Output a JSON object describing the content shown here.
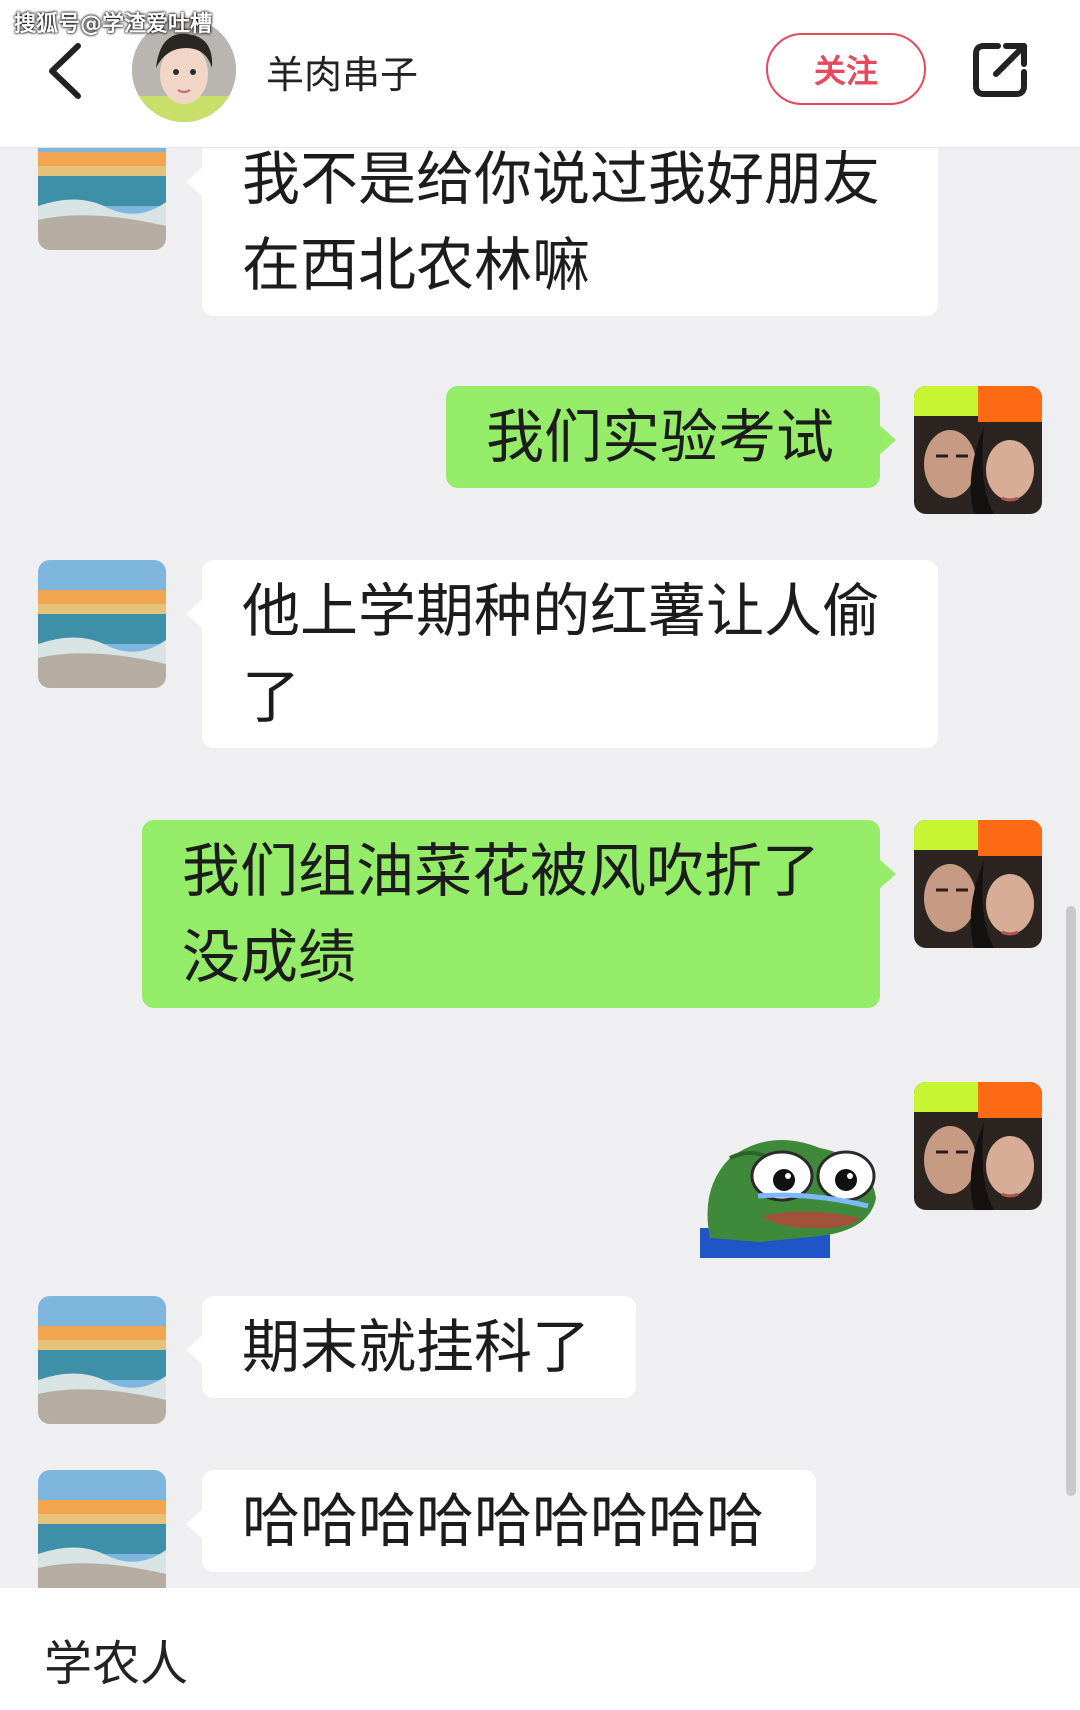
{
  "watermark": "搜狐号@学渣爱吐槽",
  "header": {
    "back_icon": "chevron-left-icon",
    "contact_name": "羊肉串子",
    "follow_label": "关注",
    "share_icon": "share-external-icon"
  },
  "messages": [
    {
      "side": "left",
      "text": "我不是给你说过我好朋友在西北农林嘛"
    },
    {
      "side": "right",
      "text": "我们实验考试"
    },
    {
      "side": "left",
      "text": "他上学期种的红薯让人偷了"
    },
    {
      "side": "right",
      "text": "我们组油菜花被风吹折了没成绩"
    },
    {
      "side": "right",
      "sticker": "crying-frog-sticker"
    },
    {
      "side": "left",
      "text": "期末就挂科了"
    },
    {
      "side": "left",
      "text": "哈哈哈哈哈哈哈哈哈"
    }
  ],
  "caption": "学农人",
  "colors": {
    "accent_red": "#e8475c",
    "self_bubble": "#95ec69",
    "other_bubble": "#ffffff",
    "chat_background": "#efeff1"
  }
}
